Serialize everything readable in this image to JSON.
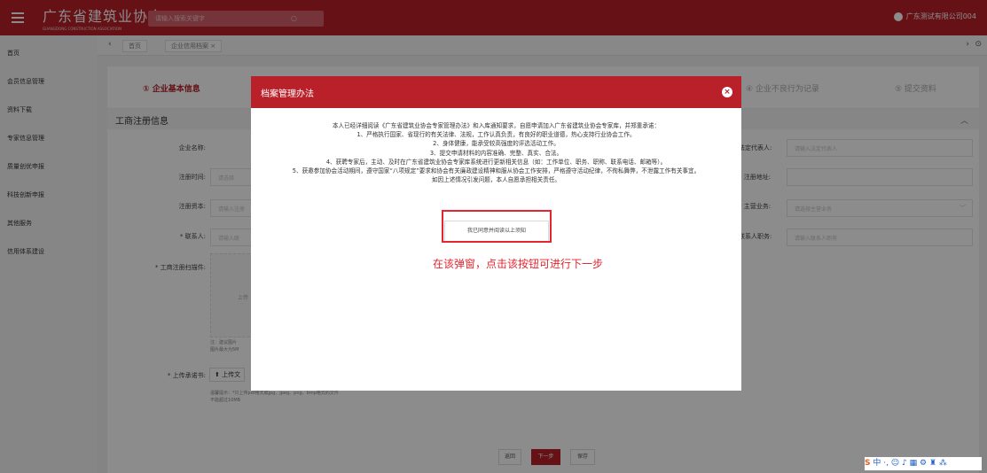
{
  "header": {
    "logo_title": "广东省建筑业协会",
    "logo_subtitle": "GUANGDONG CONSTRUCTION ASSOCIATION",
    "search_placeholder": "请输入搜索关键字",
    "user_name": "广东测试有限公司004"
  },
  "sidebar": {
    "items": [
      {
        "label": "首页"
      },
      {
        "label": "会员信息管理"
      },
      {
        "label": "资料下载"
      },
      {
        "label": "专家信息管理"
      },
      {
        "label": "质量创优申报"
      },
      {
        "label": "科技创新申报"
      },
      {
        "label": "其他服务"
      },
      {
        "label": "信用体系建设"
      }
    ]
  },
  "tabs": [
    {
      "label": "首页"
    },
    {
      "label": "企业信用档案"
    }
  ],
  "tab_close_glyph": "×",
  "steps": [
    {
      "label": "① 企业基本信息",
      "active": true
    },
    {
      "label": "④ 企业不良行为记录",
      "active": false
    },
    {
      "label": "⑤ 提交资料",
      "active": false
    }
  ],
  "section": {
    "title": "工商注册信息"
  },
  "form_left": [
    {
      "label": "企业名称:"
    },
    {
      "label": "注册时间:",
      "placeholder": "请选择"
    },
    {
      "label": "注册资本:",
      "placeholder": "请输入注册"
    },
    {
      "label": "* 联系人:",
      "placeholder": "请输入联"
    }
  ],
  "form_right": [
    {
      "label": "法定代表人:",
      "placeholder": "请输入法定代表人"
    },
    {
      "label": "* 注册地址:",
      "placeholder": ""
    },
    {
      "label": "* 主营业务:",
      "placeholder": "请选择主营业务"
    },
    {
      "label": "联系人职务:",
      "placeholder": "请输入联系人职务"
    }
  ],
  "upload": {
    "scan_label": "* 工商注册扫描件:",
    "scan_inner": "上传",
    "scan_note_1": "注：建议图片",
    "scan_note_2": "图片最大为5M",
    "commit_label": "* 上传承诺书:",
    "commit_button": "上传文",
    "commit_note_1": "温馨提示：*只上传pdf格式或jpg、jpeg、png、bmp格式的文件",
    "commit_note_2": "不能超过10MB"
  },
  "bottom_buttons": {
    "back": "返回",
    "next": "下一步",
    "save": "保存"
  },
  "modal": {
    "title": "档案管理办法",
    "lines": [
      "本人已经详细阅读《广东省建筑业协会专家管理办法》和入库通知要求，自愿申请加入广东省建筑业协会专家库，并郑重承诺：",
      "1、严格执行国家、省现行的有关法律、法规，工作认真负责，有良好的职业道德，热心支持行业协会工作。",
      "2、身体健康，能承受较高强度的评选活动工作。",
      "3、提交申请材料的内容准确、完整、真实、合法。",
      "4、获聘专家后，主动、及时在广东省建筑业协会专家库系统进行更新相关信息（如：工作单位、职务、职称、联系电话、邮箱等）。",
      "5、获邀参加协会活动期间，遵守国家“八项规定”要求和协会有关廉政建设精神和服从协会工作安排，严格遵守活动纪律，不徇私舞弊，不泄露工作有关事宜。",
      "如因上述情况引发问题，本人自愿承担相关责任。"
    ],
    "agree_button": "我已同意并阅读以上须知",
    "close_glyph": "×"
  },
  "annotation_text": "在该弹窗，点击该按钮可进行下一步",
  "ime_toolbar": "中 ·, ☺ ♪ ▦ ⚙ ♜ ⁂",
  "ime_badge": "S",
  "colors": {
    "brand_red": "#b92029",
    "annotation_red": "#e3262f"
  }
}
